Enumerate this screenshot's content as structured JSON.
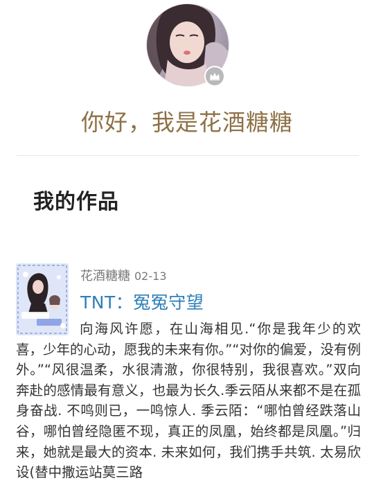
{
  "profile": {
    "avatar_icon": "avatar-photo",
    "badge_icon": "crown-icon",
    "greeting": "你好，我是花酒糖糖"
  },
  "section": {
    "title": "我的作品"
  },
  "works": [
    {
      "cover_icon": "book-cover",
      "author": "花酒糖糖",
      "date": "02-13",
      "title": "TNT：冤冤守望",
      "summary": "向海风许愿，在山海相见.“你是我年少的欢喜，少年的心动，愿我的未来有你。”“对你的偏爱，没有例外。”“风很温柔，水很清澈，你很特别，我很喜欢。”双向奔赴的感情最有意义，也最为长久.季云陌从来都不是在孤身奋战. 不鸣则已，一鸣惊人. 季云陌：“哪怕曾经跌落山谷，哪怕曾经隐匿不现，真正的凤凰，始终都是凤凰。”归来，她就是最大的资本. 未来如何，我们携手共筑. 太易欣设(替中撒运站莫三路"
    }
  ],
  "colors": {
    "greeting": "#8e7146",
    "work_title": "#2f7fb8",
    "meta": "#787878"
  }
}
